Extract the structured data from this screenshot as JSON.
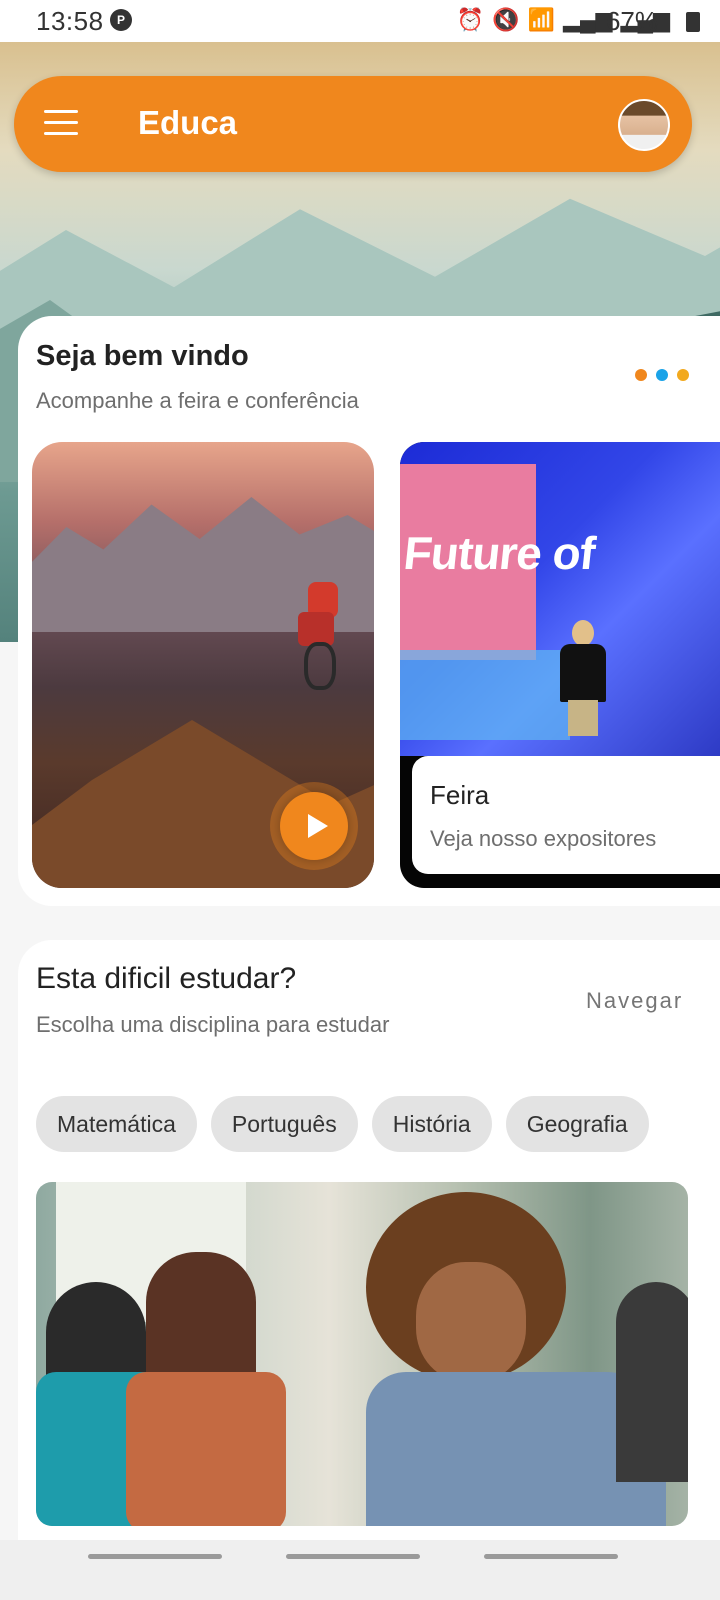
{
  "status_bar": {
    "time": "13:58",
    "notification_icon": "P",
    "icons": [
      "alarm-icon",
      "mute-icon",
      "wifi-icon",
      "signal-icon",
      "signal-icon"
    ],
    "battery_text": "67%"
  },
  "app_bar": {
    "title": "Educa",
    "menu_icon": "menu-icon",
    "avatar": "user-avatar"
  },
  "welcome": {
    "title": "Seja bem vindo",
    "subtitle": "Acompanhe a feira e conferência",
    "pager_dot_colors": [
      "#f0871d",
      "#1aa3e8",
      "#f2a91e"
    ],
    "cards": [
      {
        "type": "video",
        "play_icon": "play-icon"
      },
      {
        "type": "info",
        "image_text": "Future of",
        "title": "Feira",
        "subtitle": "Veja nosso expositores"
      }
    ]
  },
  "study": {
    "title": "Esta dificil estudar?",
    "subtitle": "Escolha uma disciplina para estudar",
    "link": "Navegar",
    "chips": [
      "Matemática",
      "Português",
      "História",
      "Geografia"
    ]
  },
  "colors": {
    "accent": "#f0871d",
    "chip_bg": "#e3e3e3"
  }
}
